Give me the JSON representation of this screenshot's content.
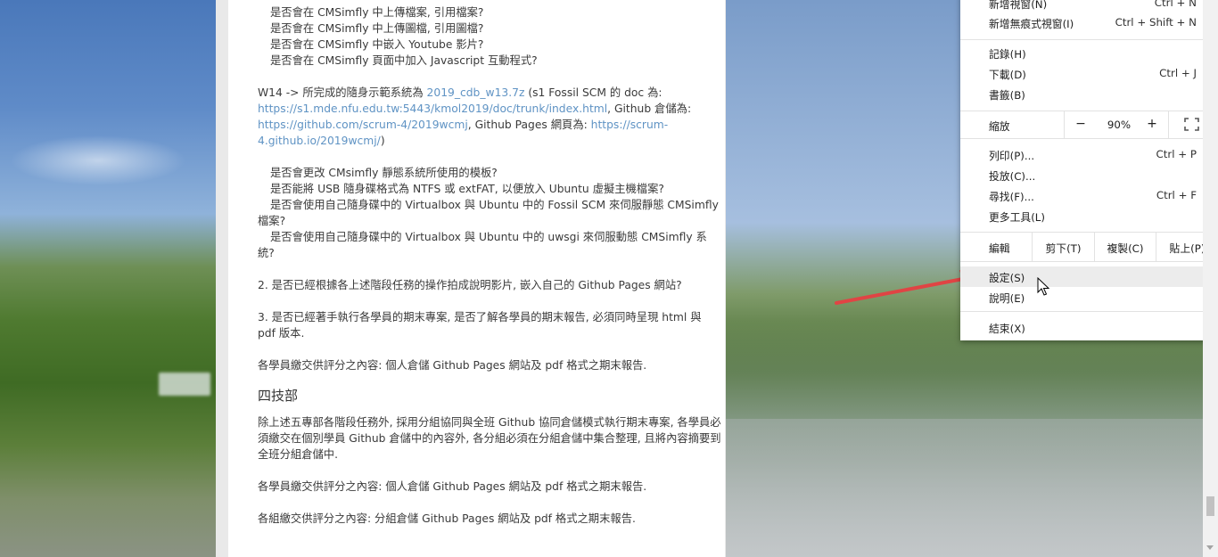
{
  "document": {
    "lines_top": [
      "是否會在 CMSimfly 中上傳檔案, 引用檔案?",
      "是否會在 CMSimfly 中上傳圖檔, 引用圖檔?",
      "是否會在 CMSimfly 中嵌入 Youtube 影片?",
      "是否會在 CMSimfly 頁面中加入 Javascript 互動程式?"
    ],
    "w14": {
      "pre": "W14 -> 所完成的隨身示範系統為 ",
      "link1": "2019_cdb_w13.7z",
      "mid1": " (s1 Fossil SCM 的 doc 為: ",
      "link2": "https://s1.mde.nfu.edu.tw:5443/kmol2019/doc/trunk/index.html",
      "mid2": ", Github 倉儲為: ",
      "link3": "https://github.com/scrum-4/2019wcmj",
      "mid3": ", Github Pages 網頁為: ",
      "link4": "https://scrum-4.github.io/2019wcmj/",
      "post": ")"
    },
    "q1": "是否會更改 CMsimfly 靜態系統所使用的模板?",
    "q2": "是否能將 USB 隨身碟格式為 NTFS 或 extFAT, 以便放入 Ubuntu 虛擬主機檔案?",
    "q3": "是否會使用自己隨身碟中的 Virtualbox 與 Ubuntu 中的 Fossil SCM 來伺服靜態 CMSimfly 檔案?",
    "q4": "是否會使用自己隨身碟中的 Virtualbox 與 Ubuntu 中的 uwsgi 來伺服動態 CMSimfly 系統?",
    "item2": "2. 是否已經根據各上述階段任務的操作拍成說明影片, 嵌入自己的 Github Pages 網站?",
    "item3": "3. 是否已經著手執行各學員的期末專案, 是否了解各學員的期末報告, 必須同時呈現 html 與 pdf 版本.",
    "submit1": "各學員繳交供評分之內容: 個人倉儲 Github Pages 網站及 pdf 格式之期末報告.",
    "heading": "四技部",
    "para1": "除上述五專部各階段任務外, 採用分組協同與全班 Github 協同倉儲模式執行期末專案, 各學員必須繳交在個別學員 Github 倉儲中的內容外, 各分組必須在分組倉儲中集合整理, 且將內容摘要到全班分組倉儲中.",
    "submit2": "各學員繳交供評分之內容: 個人倉儲 Github Pages 網站及 pdf 格式之期末報告.",
    "submit3": "各組繳交供評分之內容: 分組倉儲 Github Pages 網站及 pdf 格式之期末報告."
  },
  "menu": {
    "new_window": {
      "label": "新增視窗(N)",
      "shortcut": "Ctrl + N"
    },
    "incognito": {
      "label": "新增無痕式視窗(I)",
      "shortcut": "Ctrl + Shift + N"
    },
    "history": {
      "label": "記錄(H)"
    },
    "downloads": {
      "label": "下載(D)",
      "shortcut": "Ctrl + J"
    },
    "bookmarks": {
      "label": "書籤(B)"
    },
    "zoom": {
      "label": "縮放",
      "minus": "−",
      "value": "90%",
      "plus": "+"
    },
    "print": {
      "label": "列印(P)...",
      "shortcut": "Ctrl + P"
    },
    "cast": {
      "label": "投放(C)..."
    },
    "find": {
      "label": "尋找(F)...",
      "shortcut": "Ctrl + F"
    },
    "more_tools": {
      "label": "更多工具(L)"
    },
    "edit": {
      "label": "編輯",
      "cut": "剪下(T)",
      "copy": "複製(C)",
      "paste": "貼上(P)"
    },
    "settings": {
      "label": "設定(S)"
    },
    "help": {
      "label": "說明(E)"
    },
    "exit": {
      "label": "結束(X)"
    }
  },
  "colors": {
    "link": "#5f93c4",
    "annotation_arrow": "#e04444",
    "menu_highlight": "#ececec"
  }
}
